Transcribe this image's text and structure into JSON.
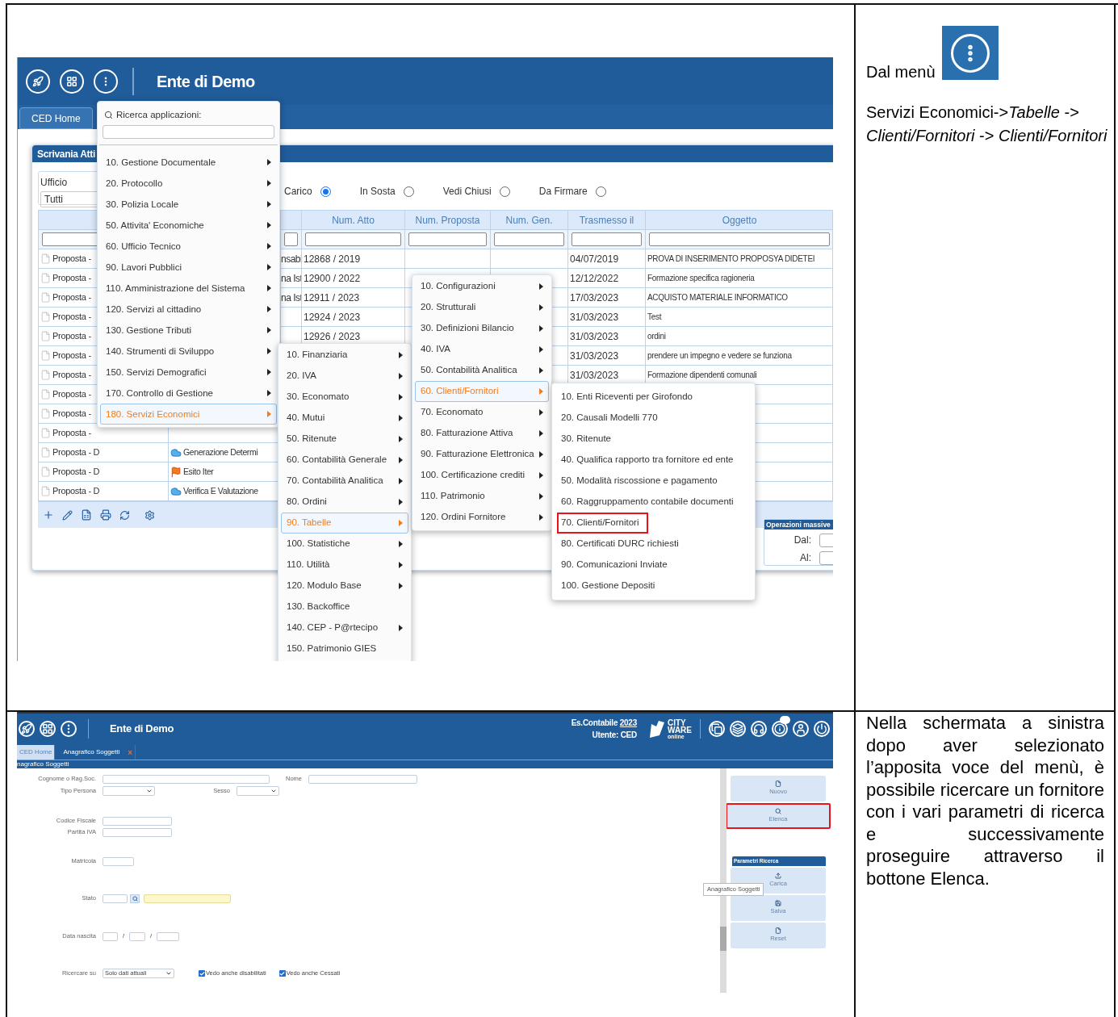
{
  "top_screenshot": {
    "app_title": "Ente di Demo",
    "tabs": [
      {
        "label": "CED Home",
        "selected": true
      }
    ],
    "panel_title": "Scrivania Atti",
    "ufficio": {
      "label": "Ufficio",
      "value": "Tutti"
    },
    "filters": [
      {
        "label": "Carico",
        "selected": true
      },
      {
        "label": "In Sosta",
        "selected": false
      },
      {
        "label": "Vedi Chiusi",
        "selected": false
      },
      {
        "label": "Da Firmare",
        "selected": false
      }
    ],
    "table": {
      "columns": [
        "Num. Atto",
        "Num. Proposta",
        "Num. Gen.",
        "Trasmesso il",
        "Oggetto"
      ],
      "rows": [
        {
          "column_1": "Proposta -",
          "column_3": "nsabi",
          "num_atto": "12868 / 2019",
          "trasmesso": "04/07/2019",
          "oggetto": "PROVA DI INSERIMENTO PROPOSYA DIDETEI"
        },
        {
          "column_1": "Proposta -",
          "column_3": "na Ist",
          "num_atto": "12900 / 2022",
          "trasmesso": "12/12/2022",
          "oggetto": "Formazione specifica ragioneria"
        },
        {
          "column_1": "Proposta -",
          "column_3": "na Ist",
          "num_atto": "12911 / 2023",
          "trasmesso": "17/03/2023",
          "oggetto": "ACQUISTO MATERIALE INFORMATICO"
        },
        {
          "column_1": "Proposta -",
          "num_atto": "12924 / 2023",
          "trasmesso": "31/03/2023",
          "oggetto": "Test"
        },
        {
          "column_1": "Proposta -",
          "num_atto": "12926 / 2023",
          "trasmesso": "31/03/2023",
          "oggetto": "ordini"
        },
        {
          "column_1": "Proposta -",
          "trasmesso": "31/03/2023",
          "oggetto": "prendere un impegno e vedere se funziona"
        },
        {
          "column_1": "Proposta -",
          "trasmesso": "31/03/2023",
          "oggetto": "Formazione dipendenti comunali"
        },
        {
          "column_1": "Proposta -"
        },
        {
          "column_1": "Proposta -"
        },
        {
          "column_1": "Proposta -"
        },
        {
          "column_1": "Proposta - D",
          "column_2": {
            "kind": "cloud",
            "text": "Generazione Determi"
          }
        },
        {
          "column_1": "Proposta - D",
          "column_2": {
            "kind": "flag",
            "text": "Esito Iter"
          }
        },
        {
          "column_1": "Proposta - D",
          "column_2": {
            "kind": "cloud",
            "text": "Verifica E Valutazione"
          }
        }
      ]
    },
    "bulk_operations": {
      "title": "Operazioni massive",
      "fields": [
        "Dal:",
        "Al:"
      ]
    },
    "app_menu": {
      "search_label": "Ricerca applicazioni:",
      "items": [
        {
          "label": "10. Gestione Documentale",
          "submenu": true,
          "selected": false
        },
        {
          "label": "20. Protocollo",
          "submenu": true,
          "selected": false
        },
        {
          "label": "30. Polizia Locale",
          "submenu": true,
          "selected": false
        },
        {
          "label": "50. Attivita' Economiche",
          "submenu": true,
          "selected": false
        },
        {
          "label": "60. Ufficio Tecnico",
          "submenu": true,
          "selected": false
        },
        {
          "label": "90. Lavori Pubblici",
          "submenu": true,
          "selected": false
        },
        {
          "label": "110. Amministrazione del Sistema",
          "submenu": true,
          "selected": false
        },
        {
          "label": "120. Servizi al cittadino",
          "submenu": true,
          "selected": false
        },
        {
          "label": "130. Gestione Tributi",
          "submenu": true,
          "selected": false
        },
        {
          "label": "140. Strumenti di Sviluppo",
          "submenu": true,
          "selected": false
        },
        {
          "label": "150. Servizi Demografici",
          "submenu": true,
          "selected": false
        },
        {
          "label": "170. Controllo di Gestione",
          "submenu": true,
          "selected": false
        },
        {
          "label": "180. Servizi Economici",
          "submenu": true,
          "selected": true
        }
      ]
    },
    "submenu_servizi_economici": [
      {
        "label": "10. Finanziaria",
        "submenu": true,
        "selected": false
      },
      {
        "label": "20. IVA",
        "submenu": true,
        "selected": false
      },
      {
        "label": "30. Economato",
        "submenu": true,
        "selected": false
      },
      {
        "label": "40. Mutui",
        "submenu": true,
        "selected": false
      },
      {
        "label": "50. Ritenute",
        "submenu": true,
        "selected": false
      },
      {
        "label": "60. Contabilità Generale",
        "submenu": true,
        "selected": false
      },
      {
        "label": "70. Contabilità Analitica",
        "submenu": true,
        "selected": false
      },
      {
        "label": "80. Ordini",
        "submenu": true,
        "selected": false
      },
      {
        "label": "90. Tabelle",
        "submenu": true,
        "selected": true
      },
      {
        "label": "100. Statistiche",
        "submenu": true,
        "selected": false
      },
      {
        "label": "110. Utilità",
        "submenu": true,
        "selected": false
      },
      {
        "label": "120. Modulo Base",
        "submenu": true,
        "selected": false
      },
      {
        "label": "130. Backoffice",
        "submenu": false,
        "selected": false
      },
      {
        "label": "140. CEP - P@rtecipo",
        "submenu": true,
        "selected": false
      },
      {
        "label": "150. Patrimonio GIES",
        "submenu": false,
        "selected": false
      }
    ],
    "submenu_tabelle": [
      {
        "label": "10. Configurazioni",
        "submenu": true,
        "selected": false
      },
      {
        "label": "20. Strutturali",
        "submenu": true,
        "selected": false
      },
      {
        "label": "30. Definizioni Bilancio",
        "submenu": true,
        "selected": false
      },
      {
        "label": "40. IVA",
        "submenu": true,
        "selected": false
      },
      {
        "label": "50. Contabilità Analitica",
        "submenu": true,
        "selected": false
      },
      {
        "label": "60. Clienti/Fornitori",
        "submenu": true,
        "selected": true
      },
      {
        "label": "70. Economato",
        "submenu": true,
        "selected": false
      },
      {
        "label": "80. Fatturazione Attiva",
        "submenu": true,
        "selected": false
      },
      {
        "label": "90. Fatturazione Elettronica",
        "submenu": true,
        "selected": false
      },
      {
        "label": "100. Certificazione crediti",
        "submenu": true,
        "selected": false
      },
      {
        "label": "110. Patrimonio",
        "submenu": true,
        "selected": false
      },
      {
        "label": "120. Ordini Fornitore",
        "submenu": true,
        "selected": false
      }
    ],
    "submenu_clienti_fornitori": [
      {
        "label": "10. Enti Riceventi per Girofondo",
        "highlighted": false
      },
      {
        "label": "20. Causali Modelli 770",
        "highlighted": false
      },
      {
        "label": "30. Ritenute",
        "highlighted": false
      },
      {
        "label": "40. Qualifica rapporto tra fornitore ed ente",
        "highlighted": false
      },
      {
        "label": "50. Modalità riscossione e pagamento",
        "highlighted": false
      },
      {
        "label": "60. Raggruppamento contabile documenti",
        "highlighted": false
      },
      {
        "label": "70. Clienti/Fornitori",
        "highlighted": true
      },
      {
        "label": "80. Certificati DURC richiesti",
        "highlighted": false
      },
      {
        "label": "90. Comunicazioni Inviate",
        "highlighted": false
      },
      {
        "label": "100. Gestione Depositi",
        "highlighted": false
      }
    ]
  },
  "top_note": {
    "lead": "Dal menù",
    "path": "Servizi Economici->*Tabelle*  -> *Clienti/Fornitori* -> *Clienti/Fornitori*"
  },
  "bottom_screenshot": {
    "app_title": "Ente di Demo",
    "fiscal_year_label": "Es.Contabile",
    "fiscal_year": "2023",
    "user": "Utente: CED",
    "logo": {
      "line_1": "CITY",
      "line_2": "WARE",
      "line_3": "online"
    },
    "tabs": [
      {
        "label": "CED Home",
        "selected": false,
        "closable": false
      },
      {
        "label": "Anagrafico Soggetti",
        "selected": true,
        "closable": true
      }
    ],
    "close_mark": "×",
    "breadcrumb": "nagrafico Soggetti",
    "form": {
      "cognome": "Cognome o Rag.Soc.",
      "nome": "Nome",
      "tipo_persona": "Tipo Persona",
      "sesso": "Sesso",
      "codice_fiscale": "Codice Fiscale",
      "partita_iva": "Partita IVA",
      "matricola": "Matricola",
      "stato": "Stato",
      "data_nascita": "Data nascita",
      "date_separator": "/",
      "ricercare_su": "Ricercare su",
      "ricercare_su_value": "Solo dati attuali",
      "checkboxes": [
        {
          "label": "Vedo anche disabilitati",
          "checked": true
        },
        {
          "label": "Vedo anche Cessati",
          "checked": true
        }
      ]
    },
    "actions": [
      {
        "label": "Nuovo",
        "kind": "file",
        "highlighted": false
      },
      {
        "label": "Elenca",
        "kind": "search",
        "highlighted": true
      }
    ],
    "search_params_title": "Parametri Ricerca",
    "param_actions": [
      {
        "label": "Carica",
        "kind": "load",
        "highlighted": false
      },
      {
        "label": "Salva",
        "kind": "save",
        "highlighted": false
      },
      {
        "label": "Reset",
        "kind": "file",
        "highlighted": false
      }
    ],
    "tooltip": "Anagrafico Soggetti"
  },
  "bottom_note": "Nella schermata a sinistra dopo aver selezionato l’apposita voce del menù, è possibile ricercare un fornitore con i vari parametri di ricerca e successivamente proseguire attraverso il bottone Elenca."
}
